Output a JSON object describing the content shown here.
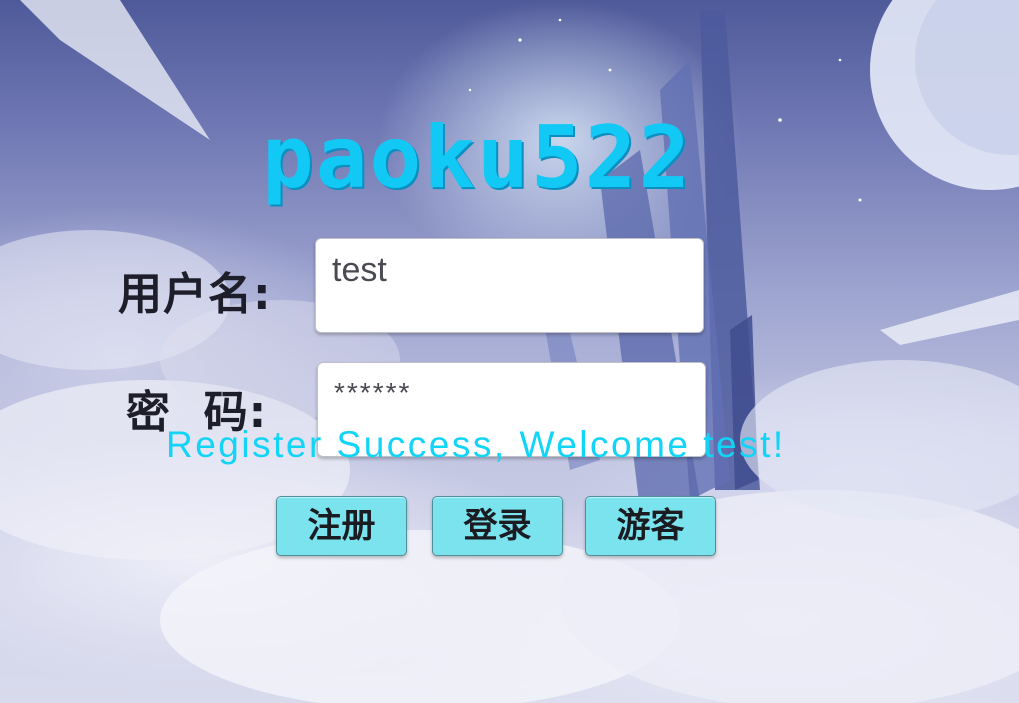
{
  "app": {
    "title": "paoku522"
  },
  "login_form": {
    "username_label": "用户名:",
    "username_value": "test",
    "password_label": "密  码:",
    "password_value": "******"
  },
  "status": {
    "message": "Register Success, Welcome test!"
  },
  "buttons": {
    "register_label": "注册",
    "login_label": "登录",
    "guest_label": "游客"
  },
  "colors": {
    "title": "#12c8f5",
    "status_text": "#12d4f7",
    "button_fill": "#7ae3ee",
    "input_fill": "#ffffff"
  }
}
